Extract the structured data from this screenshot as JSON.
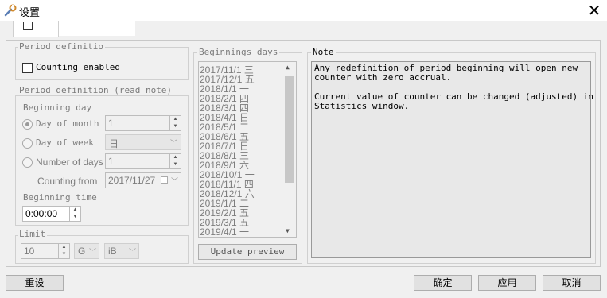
{
  "window": {
    "title": "设置",
    "close_glyph": "✕"
  },
  "period_definition_top": {
    "legend": "Period definitio",
    "checkbox_label": "Counting enabled"
  },
  "period_definition": {
    "legend": "Period definition (read note)",
    "beginning_day_label": "Beginning day",
    "day_of_month_label": "Day of month",
    "day_of_month_value": "1",
    "day_of_week_label": "Day of week",
    "day_of_week_value": "日",
    "number_of_days_label": "Number of days",
    "number_of_days_value": "1",
    "counting_from_label": "Counting from",
    "counting_from_value": "2017/11/27",
    "beginning_time_label": "Beginning time",
    "beginning_time_value": "0:00:00"
  },
  "limit": {
    "legend": "Limit",
    "value": "10",
    "unit1": "G",
    "unit2": "iB"
  },
  "beginnings": {
    "legend": "Beginnings days",
    "items": [
      "2017/11/1 三",
      "2017/12/1 五",
      "2018/1/1 一",
      "2018/2/1 四",
      "2018/3/1 四",
      "2018/4/1 日",
      "2018/5/1 二",
      "2018/6/1 五",
      "2018/7/1 日",
      "2018/8/1 三",
      "2018/9/1 六",
      "2018/10/1 一",
      "2018/11/1 四",
      "2018/12/1 六",
      "2019/1/1 二",
      "2019/2/1 五",
      "2019/3/1 五",
      "2019/4/1 一"
    ],
    "update_button": "Update preview"
  },
  "note": {
    "legend": "Note",
    "text": "Any redefinition of period beginning will open new\ncounter with zero accrual.\n\nCurrent value of counter can be changed (adjusted) in\nStatistics window."
  },
  "footer": {
    "reset": "重设",
    "ok": "确定",
    "apply": "应用",
    "cancel": "取消"
  },
  "colors": {
    "accent": "#0078d7",
    "background": "#f0f0f0"
  }
}
